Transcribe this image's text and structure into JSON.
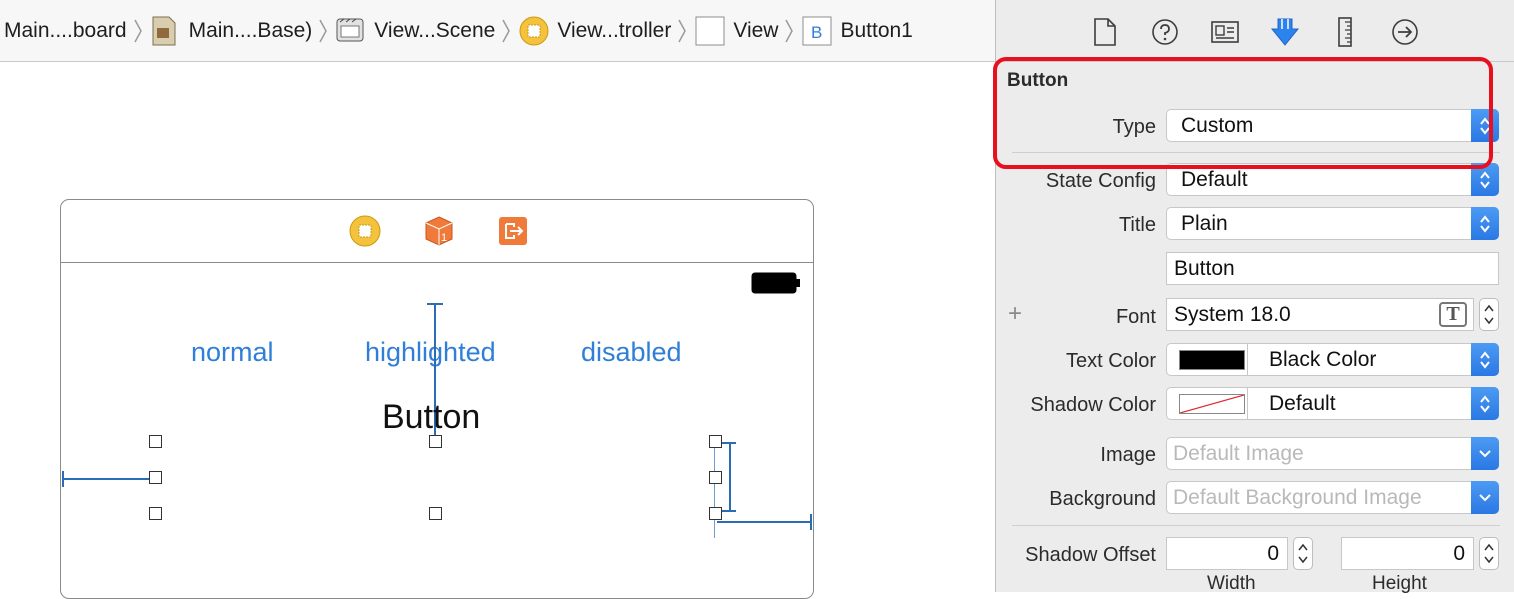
{
  "breadcrumb": [
    {
      "label": "Main....board",
      "icon": "storyboard-icon"
    },
    {
      "label": "Main....Base)",
      "icon": "storyboard-base-icon"
    },
    {
      "label": "View...Scene",
      "icon": "scene-icon"
    },
    {
      "label": "View...troller",
      "icon": "view-controller-icon"
    },
    {
      "label": "View",
      "icon": "view-icon"
    },
    {
      "label": "Button1",
      "icon": "button-icon"
    }
  ],
  "canvas": {
    "states": [
      "normal",
      "highlighted",
      "disabled"
    ],
    "center_button": "Button"
  },
  "inspector": {
    "tabs": [
      "file-inspector-icon",
      "help-icon",
      "identity-icon",
      "attributes-icon",
      "size-icon",
      "connections-icon"
    ],
    "section_title": "Button",
    "type_label": "Type",
    "type_value": "Custom",
    "state_config_label": "State Config",
    "state_config_value": "Default",
    "title_label": "Title",
    "title_value": "Plain",
    "title_text": "Button",
    "font_label": "Font",
    "font_value": "System 18.0",
    "text_color_label": "Text Color",
    "text_color_value": "Black Color",
    "shadow_color_label": "Shadow Color",
    "shadow_color_value": "Default",
    "image_label": "Image",
    "image_placeholder": "Default Image",
    "background_label": "Background",
    "background_placeholder": "Default Background Image",
    "shadow_offset_label": "Shadow Offset",
    "shadow_offset_width": "0",
    "shadow_offset_height": "0",
    "width_label": "Width",
    "height_label": "Height",
    "add_symbol": "+",
    "font_picker_symbol": "T"
  },
  "colors": {
    "accent": "#2f7fd8",
    "highlight": "#e8101f",
    "text_color_swatch": "#000000"
  }
}
